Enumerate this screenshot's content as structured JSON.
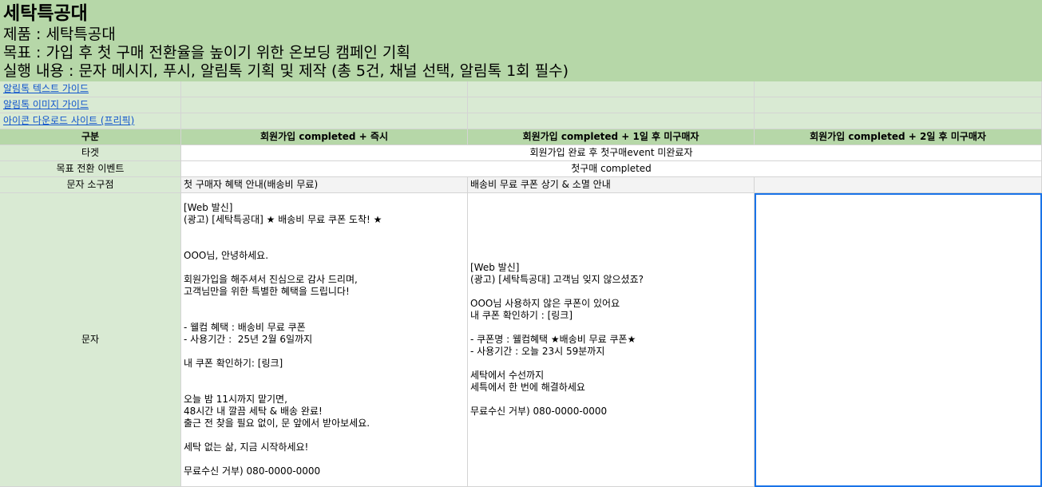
{
  "header": {
    "title": "세탁특공대",
    "product": "제품 : 세탁특공대",
    "goal": "목표 : 가입 후 첫 구매 전환율을 높이기 위한 온보딩 캠페인 기획",
    "task": "실행 내용 : 문자 메시지, 푸시, 알림톡 기획 및 제작 (총 5건, 채널 선택, 알림톡 1회 필수)"
  },
  "links": {
    "text_guide": "알림톡 텍스트 가이드",
    "image_guide": "알림톡 이미지 가이드",
    "icon_site": "아이콘 다운로드 사이트 (프리픽)"
  },
  "table": {
    "col_header": "구분",
    "columns": [
      "회원가입 completed + 즉시",
      "회원가입 completed + 1일 후 미구매자",
      "회원가입 completed + 2일 후 미구매자"
    ],
    "target_label": "타겟",
    "target_value": "회원가입 완료 후 첫구매event 미완료자",
    "event_label": "목표 전환 이벤트",
    "event_value": "첫구매 completed",
    "hook_label": "문자 소구점",
    "hooks": [
      "첫 구매자 혜택 안내(배송비 무료)",
      "배송비 무료 쿠폰 상기 & 소멸 안내",
      ""
    ],
    "message_label": "문자",
    "messages": [
      "[Web 발신]\n(광고) [세탁특공대] ★ 배송비 무료 쿠폰 도착! ★\n\n\nOOO님, 안녕하세요.\n\n회원가입을 해주셔서 진심으로 감사 드리며,\n고객님만을 위한 특별한 혜택을 드립니다!\n\n\n- 웰컴 혜택 : 배송비 무료 쿠폰\n- 사용기간 :  25년 2월 6일까지\n\n내 쿠폰 확인하기: [링크]\n\n\n오늘 밤 11시까지 맡기면,\n48시간 내 깔끔 세탁 & 배송 완료!\n출근 전 찾을 필요 없이, 문 앞에서 받아보세요.\n\n세탁 없는 삶, 지금 시작하세요!\n\n무료수신 거부) 080-0000-0000",
      "[Web 발신]\n(광고) [세탁특공대] 고객님 잊지 않으셨죠?\n\nOOO님 사용하지 않은 쿠폰이 있어요\n내 쿠폰 확인하기 : [링크]\n\n- 쿠폰명 : 웰컴혜택 ★배송비 무료 쿠폰★\n- 사용기간 : 오늘 23시 59분까지\n\n세탁에서 수선까지\n세특에서 한 번에 해결하세요\n\n무료수신 거부) 080-0000-0000",
      ""
    ]
  }
}
